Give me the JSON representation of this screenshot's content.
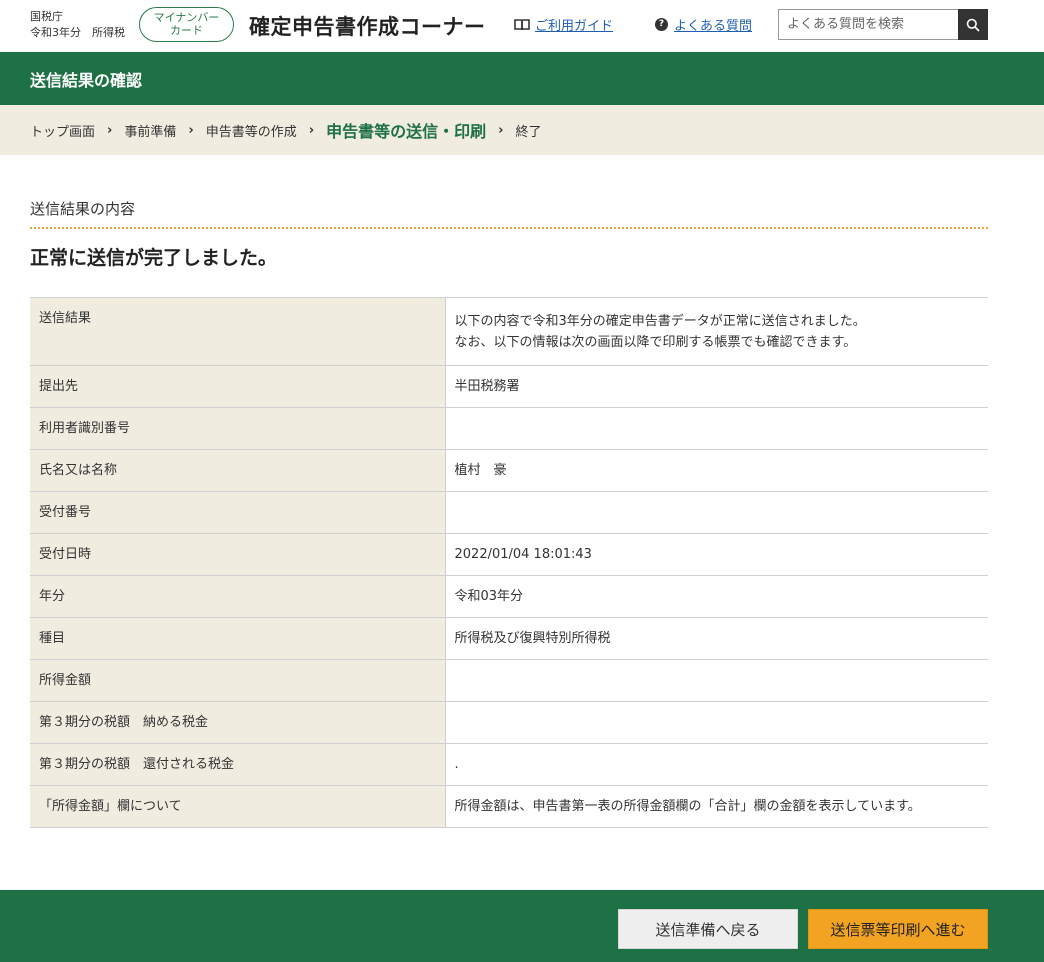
{
  "header": {
    "agency": "国税庁",
    "tax_year_label": "令和3年分　所得税",
    "mynumber_badge_line1": "マイナンバー",
    "mynumber_badge_line2": "カード",
    "site_title": "確定申告書作成コーナー",
    "guide_link": "ご利用ガイド",
    "faq_link": "よくある質問",
    "search_placeholder": "よくある質問を検索"
  },
  "page_title": "送信結果の確認",
  "breadcrumb": {
    "items": [
      "トップ画面",
      "事前準備",
      "申告書等の作成",
      "申告書等の送信・印刷",
      "終了"
    ],
    "current_index": 3
  },
  "content": {
    "section_label": "送信結果の内容",
    "heading": "正常に送信が完了しました。",
    "rows": [
      {
        "label": "送信結果",
        "value_line1": "以下の内容で令和3年分の確定申告書データが正常に送信されました。",
        "value_line2": "なお、以下の情報は次の画面以降で印刷する帳票でも確認できます。"
      },
      {
        "label": "提出先",
        "value": "半田税務署"
      },
      {
        "label": "利用者識別番号",
        "value": ""
      },
      {
        "label": "氏名又は名称",
        "value": "植村　豪"
      },
      {
        "label": "受付番号",
        "value": ""
      },
      {
        "label": "受付日時",
        "value": "2022/01/04 18:01:43"
      },
      {
        "label": "年分",
        "value": "令和03年分"
      },
      {
        "label": "種目",
        "value": "所得税及び復興特別所得税"
      },
      {
        "label": "所得金額",
        "value": ""
      },
      {
        "label": "第３期分の税額　納める税金",
        "value": ""
      },
      {
        "label": "第３期分の税額　還付される税金",
        "value": "."
      },
      {
        "label": "「所得金額」欄について",
        "value": "所得金額は、申告書第一表の所得金額欄の「合計」欄の金額を表示しています。"
      }
    ]
  },
  "footer": {
    "back_button": "送信準備へ戻る",
    "next_button": "送信票等印刷へ進む"
  },
  "colors": {
    "brand_green": "#1e7145",
    "breadcrumb_bg": "#f0ece0",
    "primary_button": "#f2a321",
    "link_blue": "#1f5fb0"
  }
}
